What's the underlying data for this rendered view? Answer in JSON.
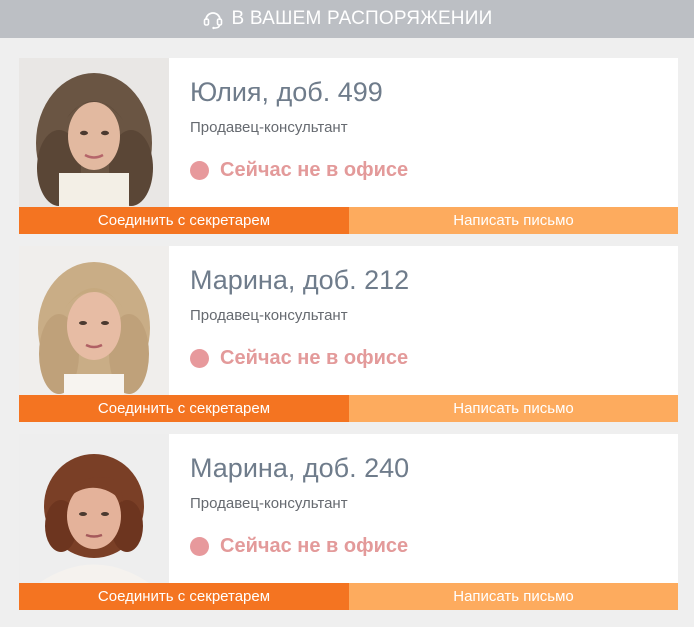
{
  "header": {
    "title": "В ВАШЕМ РАСПОРЯЖЕНИИ",
    "icon": "headset-icon"
  },
  "colors": {
    "header_bg": "#bcbfc4",
    "connect_button": "#f47421",
    "write_button": "#fdab5e",
    "status_text": "#e39a9a",
    "status_dot": "#e7999c",
    "name_text": "#6f7c8b"
  },
  "contacts": [
    {
      "name": "Юлия, доб. 499",
      "role": "Продавец-консультант",
      "status": "Сейчас не в офисе",
      "connect_label": "Соединить с секретарем",
      "write_label": "Написать письмо"
    },
    {
      "name": "Марина, доб. 212",
      "role": "Продавец-консультант",
      "status": "Сейчас не в офисе",
      "connect_label": "Соединить с секретарем",
      "write_label": "Написать письмо"
    },
    {
      "name": "Марина, доб. 240",
      "role": "Продавец-консультант",
      "status": "Сейчас не в офисе",
      "connect_label": "Соединить с секретарем",
      "write_label": "Написать письмо"
    }
  ]
}
